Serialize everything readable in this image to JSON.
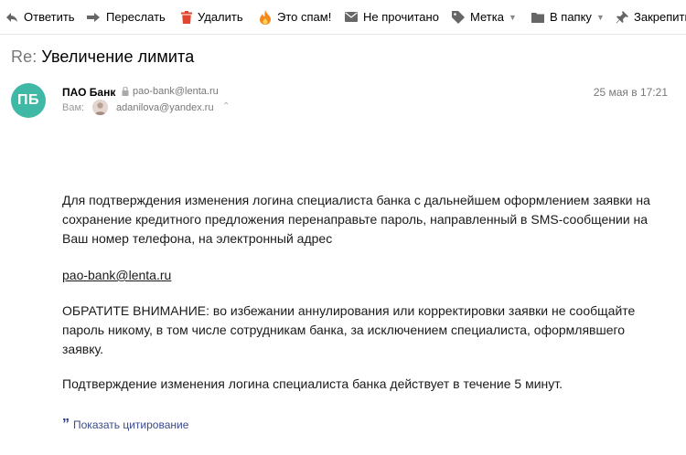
{
  "toolbar": {
    "reply": "Ответить",
    "forward": "Переслать",
    "delete": "Удалить",
    "spam": "Это спам!",
    "unread": "Не прочитано",
    "label": "Метка",
    "folder": "В папку",
    "pin": "Закрепить"
  },
  "message": {
    "subject_prefix": "Re:",
    "subject": "Увеличение лимита",
    "sender": {
      "initials": "ПБ",
      "name": "ПАО Банк",
      "email": "pao-bank@lenta.ru"
    },
    "to_label": "Вам:",
    "recipient_email": "adanilova@yandex.ru",
    "date": "25 мая в 17:21",
    "body": {
      "paragraph1": "Для подтверждения изменения логина специалиста банка с дальнейшем оформлением заявки на сохранение кредитного предложения перенаправьте пароль, направленный в SMS-сообщении на Ваш номер телефона, на электронный адрес",
      "link": "pao-bank@lenta.ru",
      "paragraph2": "ОБРАТИТЕ ВНИМАНИЕ: во избежании аннулирования или корректировки заявки не сообщайте пароль никому, в том числе сотрудникам банка, за исключением специалиста, оформлявшего заявку.",
      "paragraph3": "Подтверждение изменения логина специалиста банка действует в течение 5 минут."
    },
    "show_quote": "Показать цитирование"
  },
  "colors": {
    "avatar_bg": "#3fb8a6",
    "delete_icon": "#e0452e",
    "spam_icon": "#f28a1e",
    "quote_link": "#3b4a8a"
  }
}
